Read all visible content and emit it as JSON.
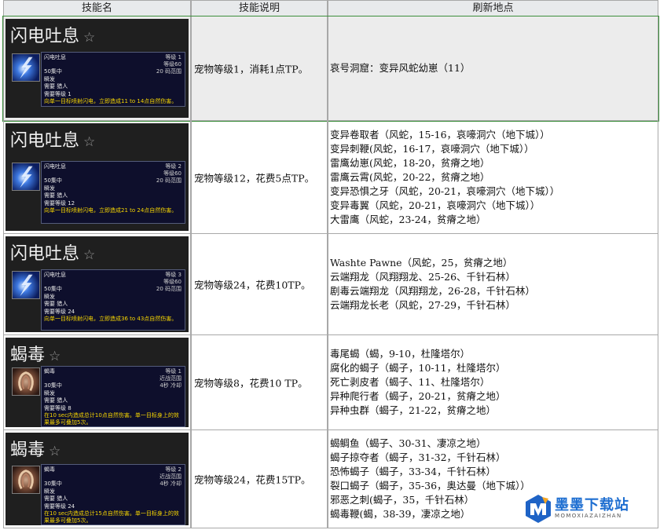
{
  "header": {
    "col_skill": "技能名",
    "col_desc": "技能说明",
    "col_loc": "刷新地点"
  },
  "rows": [
    {
      "skill": {
        "name": "闪电吐息",
        "star": "☆",
        "icon": "lightning-icon",
        "tip_name": "闪电吐息",
        "rank": "等级 1",
        "range": "等级60",
        "range2": "20 码范围",
        "cost": "50集中",
        "cast": "瞬发",
        "req1": "需要 猎人",
        "req2": "需要等级 1",
        "effect": "向单一目标喷射闪电，立即造成11 to 14点自然伤害。"
      },
      "desc": "宠物等级1，消耗1点TP。",
      "locations": [
        "哀号洞窟：变异风蛇幼崽（11）"
      ]
    },
    {
      "skill": {
        "name": "闪电吐息",
        "star": "☆",
        "icon": "lightning-icon",
        "tip_name": "闪电吐息",
        "rank": "等级 2",
        "range": "等级60",
        "range2": "20 码范围",
        "cost": "50集中",
        "cast": "瞬发",
        "req1": "需要 猎人",
        "req2": "需要等级 12",
        "effect": "向单一目标喷射闪电，立即造成21 to 24点自然伤害。"
      },
      "desc": "宠物等级12，花费5点TP。",
      "locations": [
        "变异卷取者（风蛇，15-16，哀嚎洞穴（地下城））",
        "变异刺鞭(风蛇，16-17，哀嚎洞穴（地下城））",
        "雷鹰幼崽(风蛇，18-20，贫瘠之地）",
        "雷鹰云霄(风蛇，20-22，贫瘠之地）",
        "变异恐惧之牙（风蛇，20-21，哀嚎洞穴（地下城））",
        "变异毒翼（风蛇，20-21，哀嚎洞穴（地下城））",
        "大雷鹰（风蛇，23-24，贫瘠之地）"
      ]
    },
    {
      "skill": {
        "name": "闪电吐息",
        "star": "☆",
        "icon": "lightning-icon",
        "tip_name": "闪电吐息",
        "rank": "等级 3",
        "range": "等级60",
        "range2": "20 码范围",
        "cost": "50集中",
        "cast": "瞬发",
        "req1": "需要 猎人",
        "req2": "需要等级 24",
        "effect": "向单一目标喷射闪电，立即造成36 to 43点自然伤害。"
      },
      "desc": "宠物等级24，花费10TP。",
      "locations": [
        "Washte Pawne（风蛇，25，贫瘠之地）",
        "云端翔龙（风翔翔龙、25-26、千针石林）",
        "剧毒云端翔龙（风翔翔龙，26-28，千针石林）",
        "云端翔龙长老（风蛇，27-29，千针石林）"
      ]
    },
    {
      "skill": {
        "name": "蝎毒",
        "star": "☆",
        "icon": "venom-icon",
        "tip_name": "蝎毒",
        "rank": "等级 1",
        "range": "近战范围",
        "range2": "4秒 冷却",
        "cost": "30集中",
        "cast": "瞬发",
        "req1": "需要 猎人",
        "req2": "需要等级 8",
        "effect": "在10 sec内造成总计10点自然伤害。单一目标身上的效果最多可叠加5次。"
      },
      "desc": "宠物等级8，花费10 TP。",
      "locations": [
        "毒尾蝎（蝎，9-10，杜隆塔尔）",
        "腐化的蝎子（蝎子，10-11，杜隆塔尔）",
        "死亡剥皮者（蝎子、11、杜隆塔尔）",
        "异种爬行者（蝎子，20-21，贫瘠之地）",
        "异种虫群（蝎子，21-22，贫瘠之地）"
      ]
    },
    {
      "skill": {
        "name": "蝎毒",
        "star": "☆",
        "icon": "venom-icon",
        "tip_name": "蝎毒",
        "rank": "等级 2",
        "range": "近战范围",
        "range2": "4秒 冷却",
        "cost": "30集中",
        "cast": "瞬发",
        "req1": "需要 猎人",
        "req2": "需要等级 24",
        "effect": "在10 sec内造成总计15点自然伤害。单一目标身上的效果最多可叠加5次。"
      },
      "desc": "宠物等级24，花费15TP。",
      "locations": [
        "蝎鲷鱼（蝎子、30-31、凄凉之地）",
        "蝎子掠夺者（蝎子，31-32，千针石林）",
        "恐怖蝎子（蝎子，33-34，千针石林）",
        "裂口蝎子（蝎子，35-36，奥达曼（地下城））",
        "邪恶之刺(蝎子，35，千针石林）",
        "蝎毒鞭(蝎，38-39，凄凉之地）"
      ]
    }
  ],
  "watermark": {
    "text": "墨墨下载站",
    "sub": "MOMOXIAZAIZHAN"
  }
}
